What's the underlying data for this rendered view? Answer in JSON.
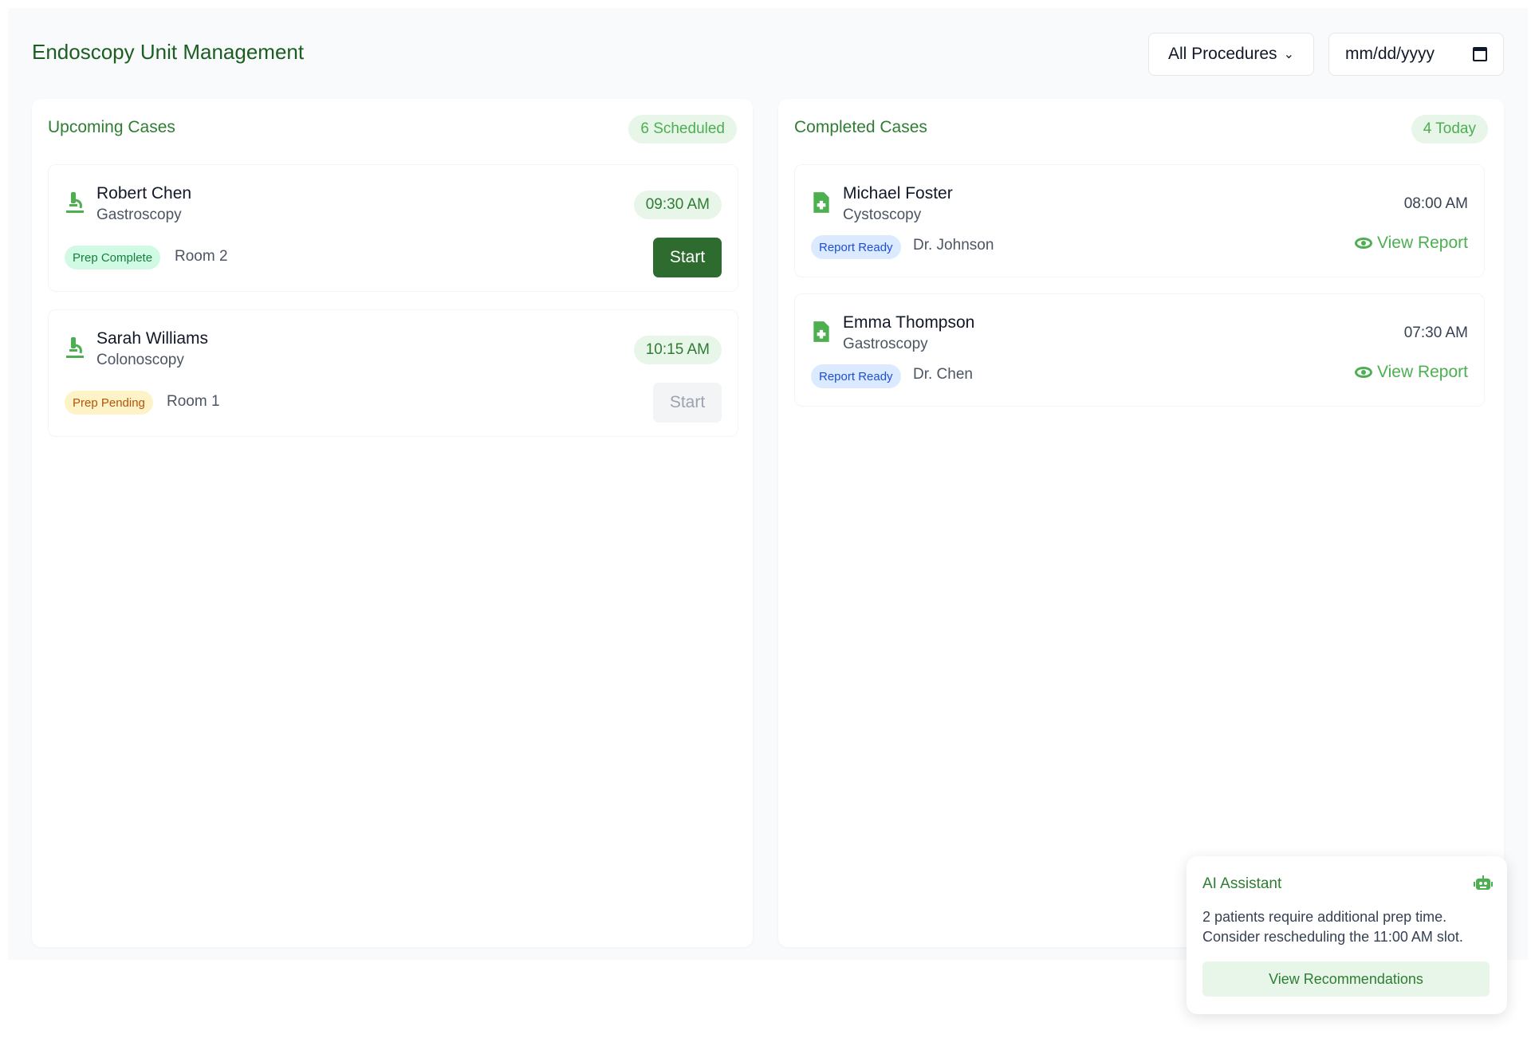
{
  "header": {
    "title": "Endoscopy Unit Management",
    "procedure_filter": "All Procedures",
    "date_placeholder": "mm/dd/yyyy"
  },
  "upcoming": {
    "title": "Upcoming Cases",
    "count": "6 Scheduled",
    "cases": [
      {
        "name": "Robert Chen",
        "procedure": "Gastroscopy",
        "time": "09:30 AM",
        "status": "Prep Complete",
        "room": "Room 2",
        "action": "Start"
      },
      {
        "name": "Sarah Williams",
        "procedure": "Colonoscopy",
        "time": "10:15 AM",
        "status": "Prep Pending",
        "room": "Room 1",
        "action": "Start"
      }
    ]
  },
  "completed": {
    "title": "Completed Cases",
    "count": "4 Today",
    "cases": [
      {
        "name": "Michael Foster",
        "procedure": "Cystoscopy",
        "time": "08:00 AM",
        "status": "Report Ready",
        "doctor": "Dr. Johnson",
        "action": "View Report"
      },
      {
        "name": "Emma Thompson",
        "procedure": "Gastroscopy",
        "time": "07:30 AM",
        "status": "Report Ready",
        "doctor": "Dr. Chen",
        "action": "View Report"
      }
    ]
  },
  "assistant": {
    "title": "AI Assistant",
    "message": "2 patients require additional prep time. Consider rescheduling the 11:00 AM slot.",
    "button": "View Recommendations"
  },
  "colors": {
    "primary": "#2e6b2f",
    "accent": "#4caf50",
    "title": "#1b5e20"
  }
}
